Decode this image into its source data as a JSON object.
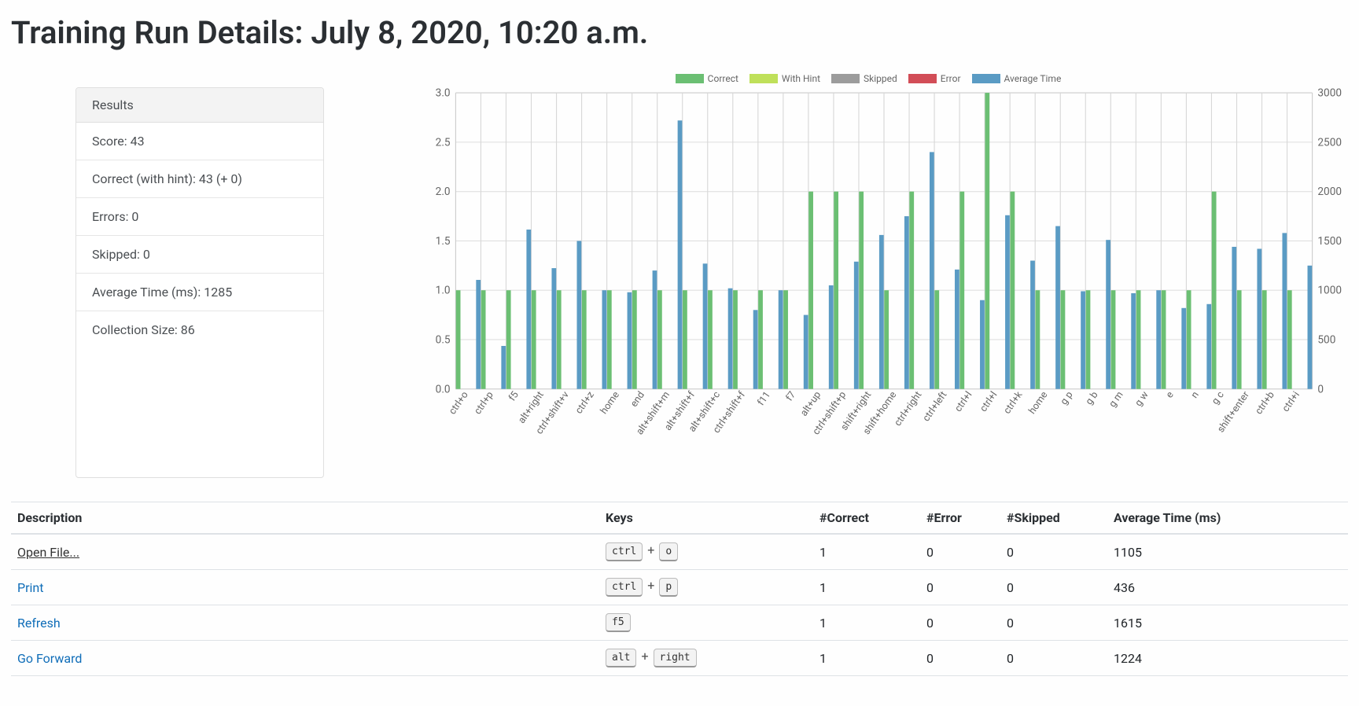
{
  "page_title": "Training Run Details: July 8, 2020, 10:20 a.m.",
  "results_card": {
    "header": "Results",
    "items": [
      "Score: 43",
      "Correct (with hint): 43 (+ 0)",
      "Errors: 0",
      "Skipped: 0",
      "Average Time (ms): 1285",
      "Collection Size: 86"
    ]
  },
  "legend": {
    "correct": {
      "label": "Correct",
      "color": "#6bbf73"
    },
    "with_hint": {
      "label": "With Hint",
      "color": "#bfe05a"
    },
    "skipped": {
      "label": "Skipped",
      "color": "#9c9c9c"
    },
    "error": {
      "label": "Error",
      "color": "#d24d57"
    },
    "avg_time": {
      "label": "Average Time",
      "color": "#5a9bc4"
    }
  },
  "chart_data": {
    "type": "bar",
    "ylim_left": [
      0,
      3.0
    ],
    "yticks_left": [
      0,
      0.5,
      1.0,
      1.5,
      2.0,
      2.5,
      3.0
    ],
    "ylim_right": [
      0,
      3000
    ],
    "yticks_right": [
      0,
      500,
      1000,
      1500,
      2000,
      2500,
      3000
    ],
    "categories": [
      "ctrl+o",
      "ctrl+p",
      "f5",
      "alt+right",
      "ctrl+shift+v",
      "ctrl+z",
      "home",
      "end",
      "alt+shift+m",
      "alt+shift+f",
      "alt+shift+c",
      "ctrl+shift+f",
      "f11",
      "f7",
      "alt+up",
      "ctrl+shift+p",
      "shift+right",
      "shift+home",
      "ctrl+right",
      "ctrl+left",
      "ctrl+l",
      "ctrl+l",
      "ctrl+k",
      "home",
      "g p",
      "g b",
      "g m",
      "g w",
      "e",
      "n",
      "g c",
      "shift+enter",
      "ctrl+b",
      "ctrl+i"
    ],
    "series": [
      {
        "name": "Correct",
        "axis": "left",
        "color": "#6bbf73",
        "values": [
          1,
          1,
          1,
          1,
          1,
          1,
          1,
          1,
          1,
          1,
          1,
          1,
          1,
          1,
          2,
          2,
          2,
          1,
          2,
          1,
          2,
          3,
          2,
          1,
          1,
          1,
          1,
          1,
          1,
          1,
          2,
          1,
          1,
          1
        ]
      },
      {
        "name": "With Hint",
        "axis": "left",
        "color": "#bfe05a",
        "values": [
          0,
          0,
          0,
          0,
          0,
          0,
          0,
          0,
          0,
          0,
          0,
          0,
          0,
          0,
          0,
          0,
          0,
          0,
          0,
          0,
          0,
          0,
          0,
          0,
          0,
          0,
          0,
          0,
          0,
          0,
          0,
          0,
          0,
          0
        ]
      },
      {
        "name": "Skipped",
        "axis": "left",
        "color": "#9c9c9c",
        "values": [
          0,
          0,
          0,
          0,
          0,
          0,
          0,
          0,
          0,
          0,
          0,
          0,
          0,
          0,
          0,
          0,
          0,
          0,
          0,
          0,
          0,
          0,
          0,
          0,
          0,
          0,
          0,
          0,
          0,
          0,
          0,
          0,
          0,
          0
        ]
      },
      {
        "name": "Error",
        "axis": "left",
        "color": "#d24d57",
        "values": [
          0,
          0,
          0,
          0,
          0,
          0,
          0,
          0,
          0,
          0,
          0,
          0,
          0,
          0,
          0,
          0,
          0,
          0,
          0,
          0,
          0,
          0,
          0,
          0,
          0,
          0,
          0,
          0,
          0,
          0,
          0,
          0,
          0,
          0
        ]
      },
      {
        "name": "Average Time",
        "axis": "right",
        "color": "#5a9bc4",
        "values": [
          1105,
          436,
          1615,
          1224,
          1500,
          1000,
          980,
          1200,
          2720,
          1270,
          1020,
          800,
          1000,
          750,
          1050,
          1290,
          1560,
          1750,
          2400,
          1210,
          900,
          1760,
          1300,
          1650,
          990,
          1510,
          970,
          1000,
          820,
          860,
          1440,
          1420,
          1580,
          1250
        ]
      }
    ]
  },
  "table": {
    "headers": {
      "description": "Description",
      "keys": "Keys",
      "correct": "#Correct",
      "error": "#Error",
      "skipped": "#Skipped",
      "avg_time": "Average Time (ms)"
    },
    "rows": [
      {
        "desc": "Open File...",
        "keys": [
          "ctrl",
          "o"
        ],
        "correct": 1,
        "error": 0,
        "skipped": 0,
        "avg_time": 1105,
        "hovered": true
      },
      {
        "desc": "Print",
        "keys": [
          "ctrl",
          "p"
        ],
        "correct": 1,
        "error": 0,
        "skipped": 0,
        "avg_time": 436
      },
      {
        "desc": "Refresh",
        "keys": [
          "f5"
        ],
        "correct": 1,
        "error": 0,
        "skipped": 0,
        "avg_time": 1615
      },
      {
        "desc": "Go Forward",
        "keys": [
          "alt",
          "right"
        ],
        "correct": 1,
        "error": 0,
        "skipped": 0,
        "avg_time": 1224
      }
    ]
  }
}
